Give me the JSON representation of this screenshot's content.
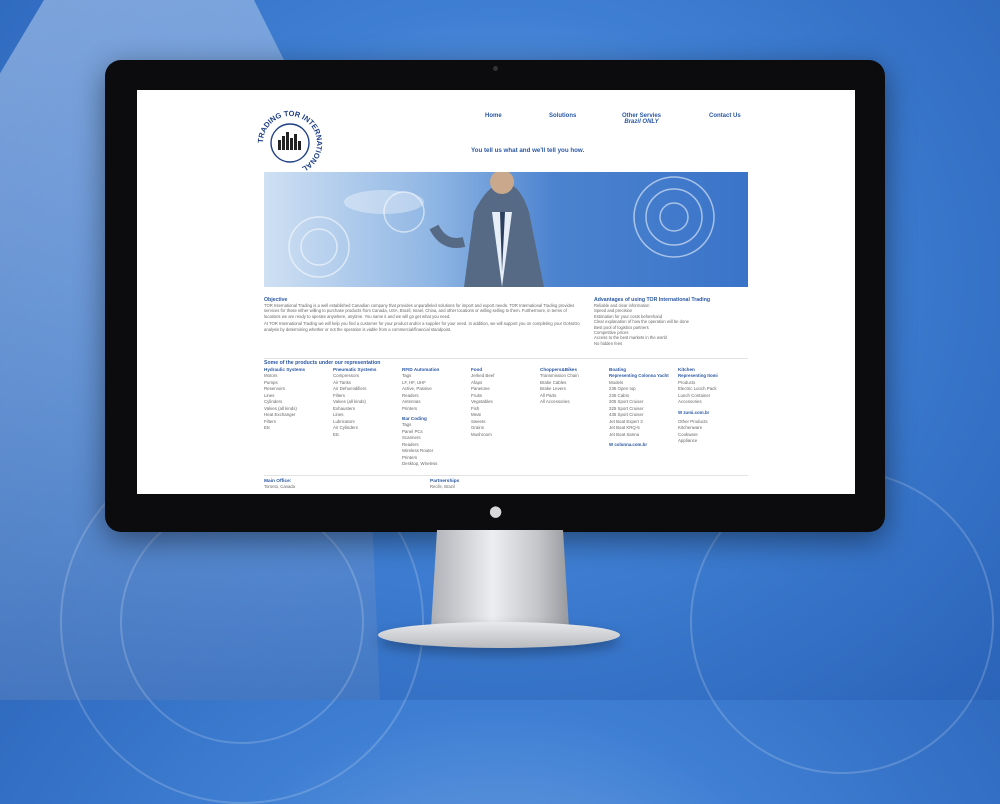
{
  "site": {
    "logo_text": "TRADING TOR INTERNATIONAL",
    "nav": [
      {
        "label": "Home"
      },
      {
        "label": "Solutions"
      },
      {
        "label": "Other Servies",
        "sub": "Brazil ONLY"
      },
      {
        "label": "Contact Us"
      }
    ],
    "tagline": "You tell us what and we'll tell you how.",
    "objective": {
      "title": "Objective",
      "p1": "TOR International Trading is a well established Canadian company that provides unparalleled solutions for import and export needs. TOR International Trading provides services for those either willing to purchase products from Canada, USA, Brazil, Israel, China, and other locations or willing selling to them. Furthermore, in terms of locations we are ready to operate anywhere, anytime. You name it and we will go get what you need.",
      "p2": "At TOR International Trading we will help you find a customer for your product and/or a supplier for your need. In addition, we will support you on completing your GoNoGo analysis by determining whether or not the operation is viable from a commercial/financial standpoint."
    },
    "advantages": {
      "title": "Advantages of using TOR International Trading",
      "items": [
        "Reliable and clear information",
        "Speed and precision",
        "Estimation for your costs beforehand",
        "Clear explanation of how the operation will be done",
        "Best pool of logistics partners",
        "Competitive prices",
        "Access to the best markets in the world",
        "No hidden fees"
      ]
    },
    "products_title": "Some of the products under our representation",
    "columns": [
      {
        "head": "Hydraulic Systems",
        "items": [
          "Motors",
          "Pumps",
          "Reservoirs",
          "Lines",
          "Cylinders",
          "Valves (all kinds)",
          "Heat Exchanger",
          "Filters",
          "Etc"
        ]
      },
      {
        "head": "Pneumatic Systems",
        "items": [
          "Compressors",
          "Air Tanks",
          "Air Dehumidifiers",
          "Filters",
          "Valves (all kinds)",
          "Exhausters",
          "Lines",
          "Lubricators",
          "Air Cylinders",
          "Etc"
        ]
      },
      {
        "head": "RFID Automation",
        "items": [
          "Tags",
          "LF, HF, UHF",
          "Active, Passive",
          "Readers",
          "Antennas",
          "Printers"
        ],
        "sub": "Bar Coding",
        "sub_items": [
          "Tags",
          "Panel PCs",
          "Scanners",
          "Readers",
          "Wireless Router",
          "Printers",
          "Desktop, Wireless"
        ]
      },
      {
        "head": "Food",
        "items": [
          "Jerked Beef",
          "Afaps",
          "Panetone",
          "Fruits",
          "Vegetables",
          "Fish",
          "Meat",
          "Sweets",
          "Grains",
          "Mushroom"
        ]
      },
      {
        "head": "Choppers&Bikes",
        "items": [
          "Transmission Chain",
          "Brake Cables",
          "Brake Levers",
          "All Parts",
          "All Accessories"
        ]
      },
      {
        "head": "Boating",
        "head2": "Representing Colonna Yacht",
        "items": [
          "Models",
          "235 Open top",
          "235 Cabin",
          "305 Sport Cruiser",
          "325 Sport Cruiser",
          "435 Sport Cruiser",
          "Jet Boat Expert 3",
          "Jet Boat KRQ-5",
          "Jet Boat Sanna"
        ],
        "link": "W colunna.com.br"
      },
      {
        "head": "Kitchen",
        "head2": "Representing Itomi",
        "items": [
          "Products",
          "Electric Lunch Pack",
          "Lunch Container",
          "Accessories"
        ],
        "link": "W zumi.com.br",
        "items2": [
          "Other Products",
          "Kitchenware",
          "Cookware",
          "Appliance"
        ]
      }
    ],
    "footer": {
      "office_title": "Main Office:",
      "office_text": "Toronto, Canada",
      "partner_title": "Partnerships",
      "partner_text": "Recife, Brazil"
    }
  }
}
